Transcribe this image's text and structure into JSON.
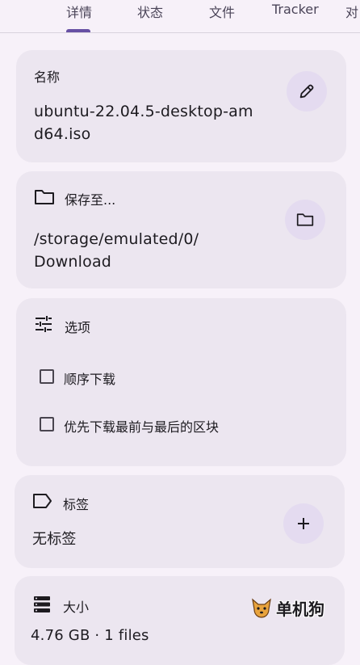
{
  "tabs": [
    {
      "label": "详情",
      "active": true
    },
    {
      "label": "状态"
    },
    {
      "label": "文件"
    },
    {
      "label": "Tracker"
    },
    {
      "label": "对"
    }
  ],
  "name_card": {
    "label": "名称",
    "value_line1": "ubuntu-22.04.5-desktop-am",
    "value_line2": "d64.iso",
    "edit_icon": "pencil-icon"
  },
  "save_card": {
    "label": "保存至...",
    "value_line1": "/storage/emulated/0/",
    "value_line2": "Download",
    "icon": "folder-icon"
  },
  "options_card": {
    "label": "选项",
    "icon": "tune-icon",
    "options": [
      {
        "label": "顺序下载",
        "checked": false
      },
      {
        "label": "优先下载最前与最后的区块",
        "checked": false
      }
    ]
  },
  "tags_card": {
    "label": "标签",
    "value": "无标签",
    "icon": "label-icon",
    "add_icon": "plus-icon"
  },
  "size_card": {
    "label": "大小",
    "value": "4.76 GB · 1 files",
    "icon": "storage-icon"
  },
  "watermark": {
    "text": "单机狗"
  },
  "colors": {
    "background": "#f7f1f9",
    "card": "#ece6f0",
    "accent": "#6750a4"
  }
}
